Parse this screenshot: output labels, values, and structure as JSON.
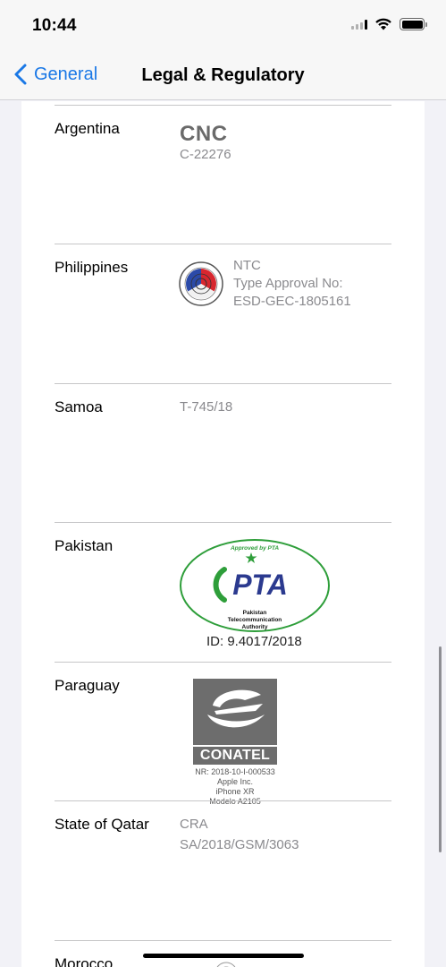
{
  "status_bar": {
    "time": "10:44"
  },
  "nav": {
    "back_label": "General",
    "title": "Legal & Regulatory"
  },
  "rows": [
    {
      "country": "Argentina",
      "logo": "CNC",
      "lines": [
        "C-22276"
      ]
    },
    {
      "country": "Philippines",
      "lines": [
        "NTC",
        "Type Approval No:",
        "ESD-GEC-1805161"
      ]
    },
    {
      "country": "Samoa",
      "lines": [
        "T-745/18"
      ]
    },
    {
      "country": "Pakistan",
      "logo": {
        "top": "Approved by PTA",
        "mark": "PTA",
        "bottom": [
          "Pakistan",
          "Telecommunication",
          "Authority"
        ]
      },
      "id": "ID: 9.4017/2018"
    },
    {
      "country": "Paraguay",
      "logo": "CONATEL",
      "lines": [
        "NR: 2018-10-I-000533",
        "Apple Inc.",
        "iPhone XR",
        "Modelo A2105"
      ]
    },
    {
      "country": "State of Qatar",
      "lines": [
        "CRA",
        "SA/2018/GSM/3063"
      ]
    },
    {
      "country": "Morocco"
    }
  ],
  "colors": {
    "accent": "#1a78e6",
    "pta_green": "#2e9e3a",
    "pta_blue": "#2b3a8f"
  }
}
